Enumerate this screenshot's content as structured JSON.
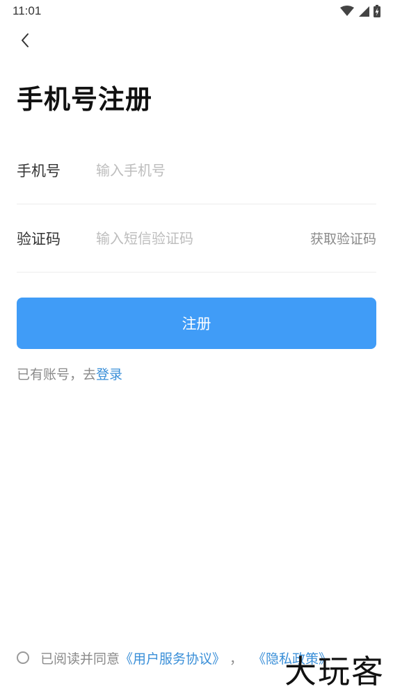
{
  "status_bar": {
    "time": "11:01",
    "icons": [
      "wifi-icon",
      "cellular-signal-icon",
      "battery-charging-icon"
    ]
  },
  "nav": {
    "back_icon": "chevron-left-icon"
  },
  "title": "手机号注册",
  "form": {
    "phone": {
      "label": "手机号",
      "placeholder": "输入手机号",
      "value": ""
    },
    "code": {
      "label": "验证码",
      "placeholder": "输入短信验证码",
      "value": "",
      "get_code_label": "获取验证码"
    }
  },
  "register_button": "注册",
  "login_prompt": {
    "text": "已有账号，去",
    "link": "登录"
  },
  "agreement": {
    "checked": false,
    "prefix": "已阅读并同意",
    "user_agreement": "《用户服务协议》",
    "separator": "，",
    "privacy_policy": "《隐私政策》"
  },
  "watermark": "大玩客",
  "colors": {
    "primary": "#409cf7",
    "link": "#3a8fd8",
    "placeholder": "#bdbdbd",
    "secondary_text": "#8a8a8a"
  }
}
